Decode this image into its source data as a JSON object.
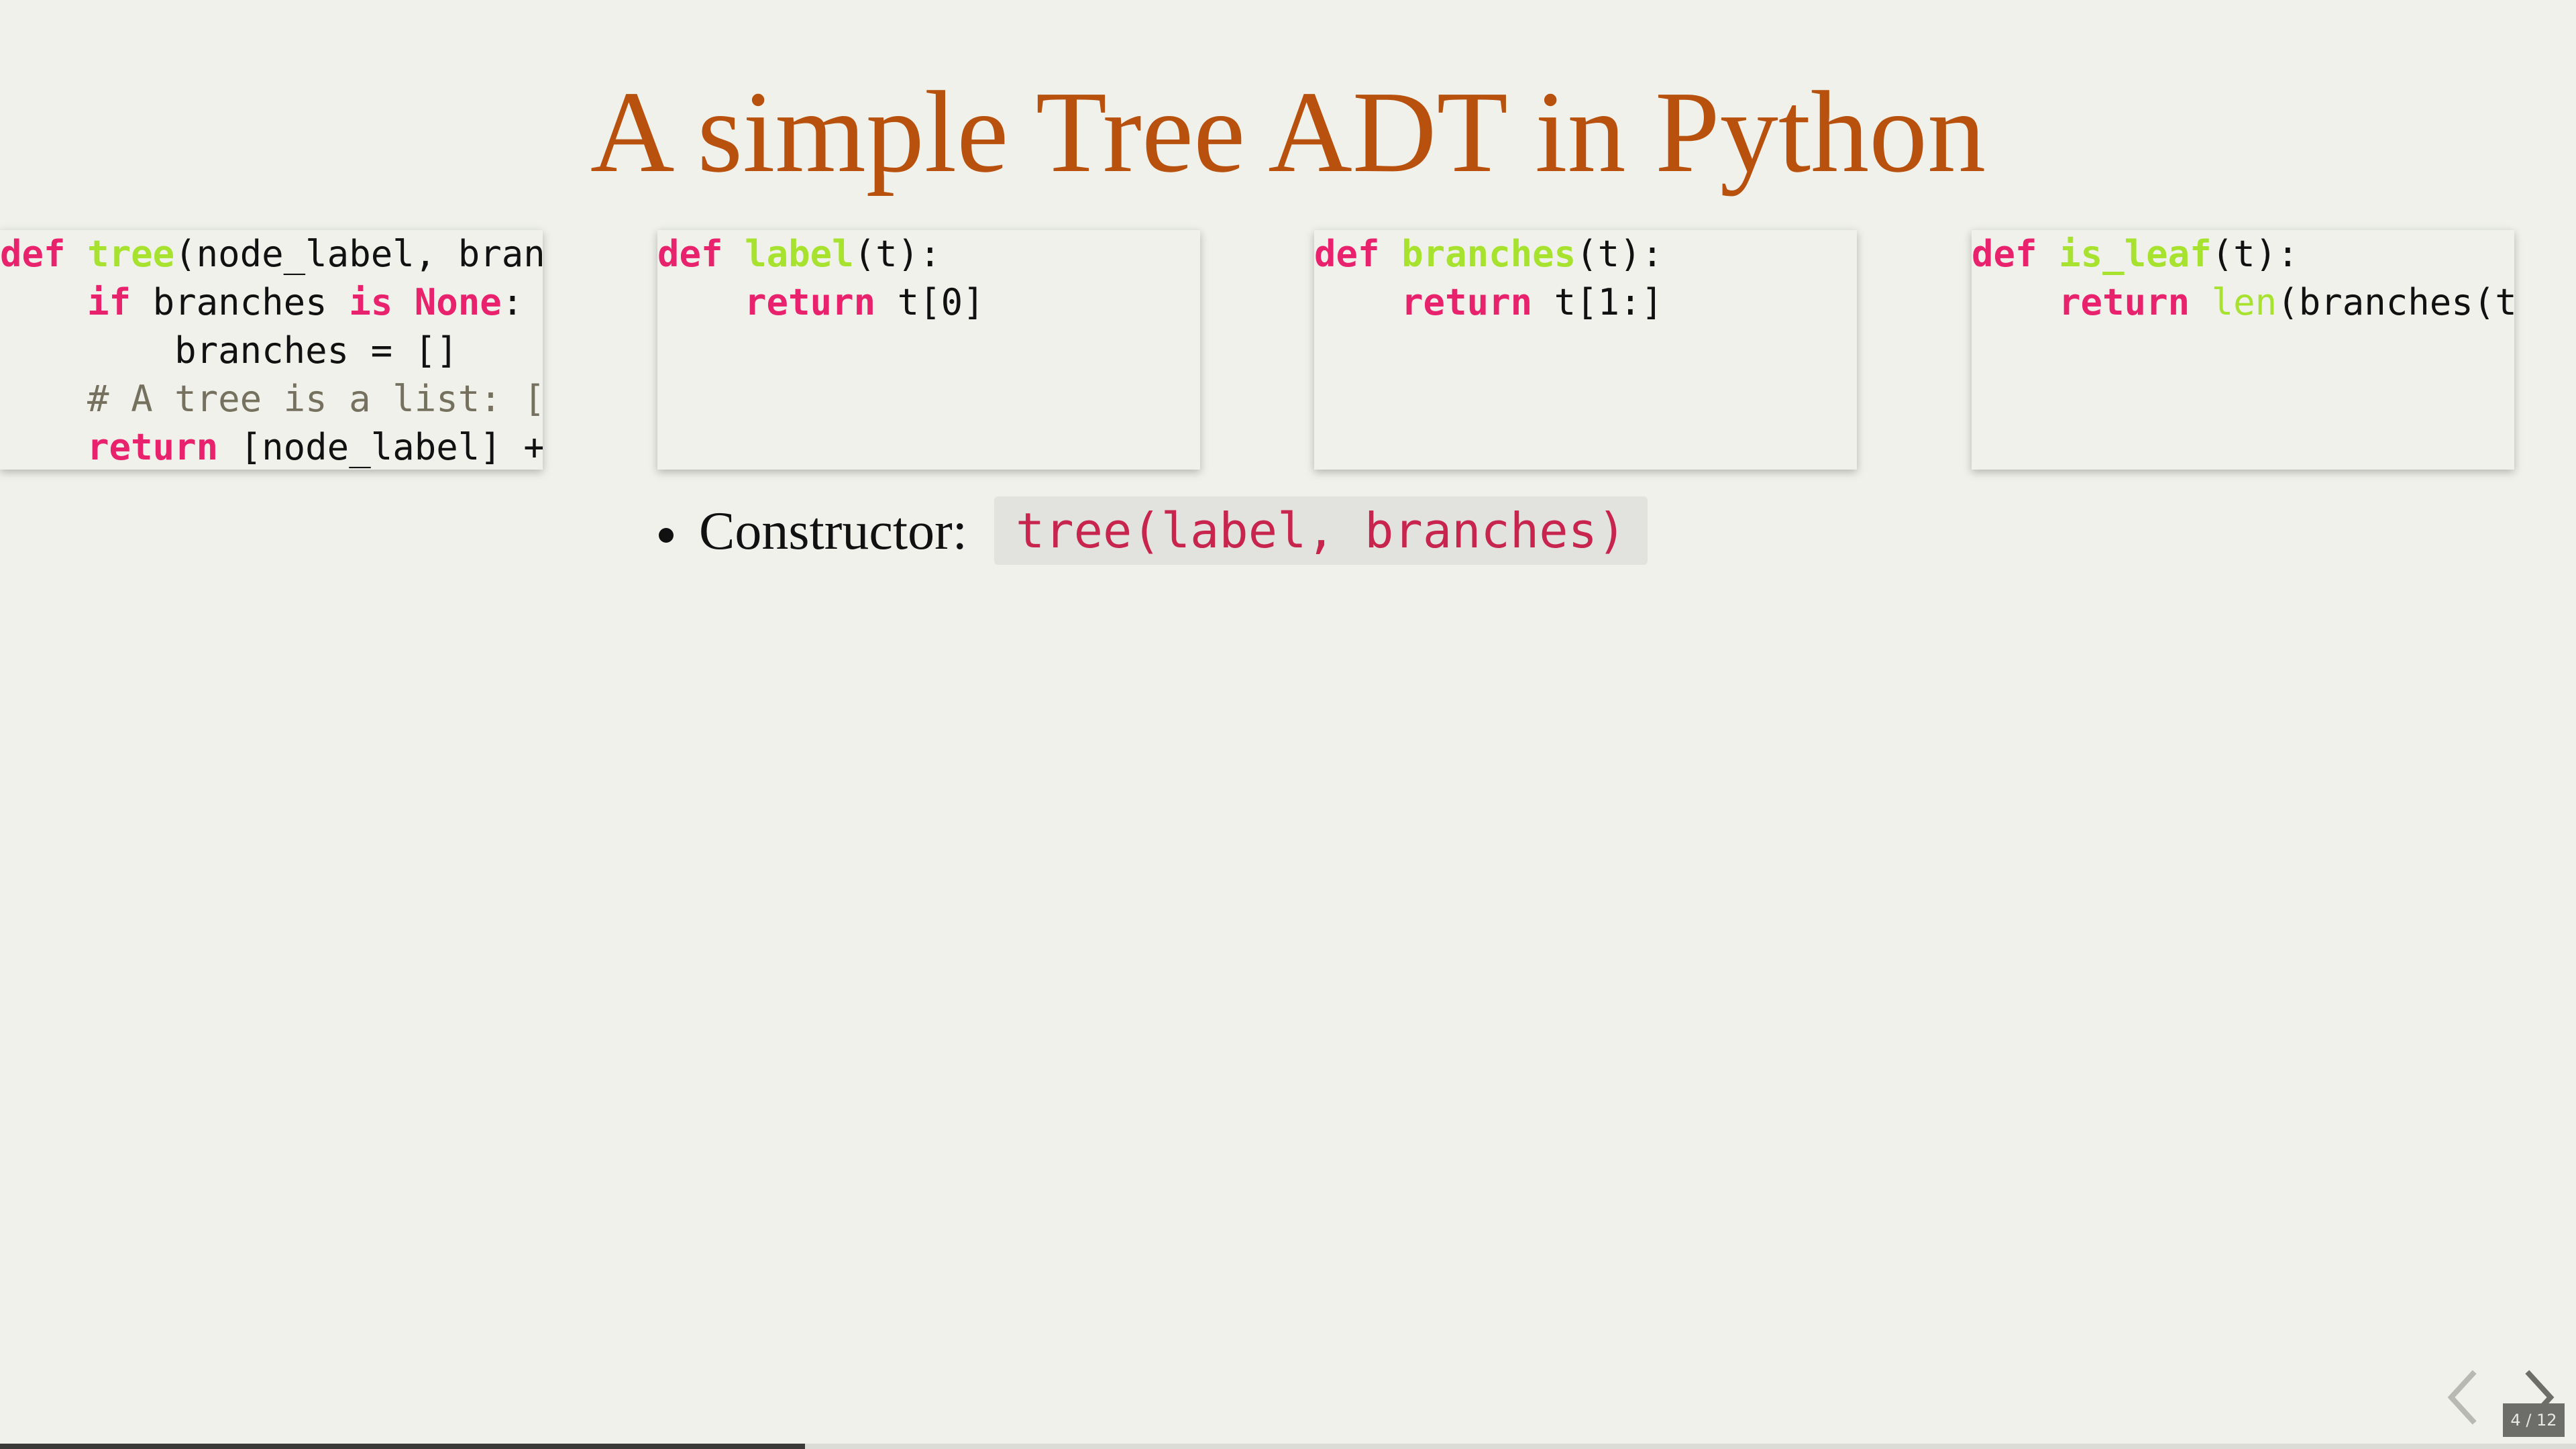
{
  "slide": {
    "title": "A simple Tree ADT in Python"
  },
  "code_boxes": [
    {
      "lines": [
        [
          {
            "t": "def",
            "c": "kw"
          },
          {
            "t": " "
          },
          {
            "t": "tree",
            "c": "fn"
          },
          {
            "t": "(node_label, bran"
          }
        ],
        [
          {
            "t": "    "
          },
          {
            "t": "if",
            "c": "kw"
          },
          {
            "t": " branches "
          },
          {
            "t": "is",
            "c": "kw"
          },
          {
            "t": " "
          },
          {
            "t": "None",
            "c": "kw"
          },
          {
            "t": ":"
          }
        ],
        [
          {
            "t": "        branches = []"
          }
        ],
        [
          {
            "t": "    "
          },
          {
            "t": "# A tree is a list: [",
            "c": "cm"
          }
        ],
        [
          {
            "t": "    "
          },
          {
            "t": "return",
            "c": "kw"
          },
          {
            "t": " [node_label] +"
          }
        ]
      ]
    },
    {
      "lines": [
        [
          {
            "t": "def",
            "c": "kw"
          },
          {
            "t": " "
          },
          {
            "t": "label",
            "c": "fn"
          },
          {
            "t": "(t):"
          }
        ],
        [
          {
            "t": "    "
          },
          {
            "t": "return",
            "c": "kw"
          },
          {
            "t": " t[0]"
          }
        ]
      ]
    },
    {
      "lines": [
        [
          {
            "t": "def",
            "c": "kw"
          },
          {
            "t": " "
          },
          {
            "t": "branches",
            "c": "fn"
          },
          {
            "t": "(t):"
          }
        ],
        [
          {
            "t": "    "
          },
          {
            "t": "return",
            "c": "kw"
          },
          {
            "t": " t[1:]"
          }
        ]
      ]
    },
    {
      "lines": [
        [
          {
            "t": "def",
            "c": "kw"
          },
          {
            "t": " "
          },
          {
            "t": "is_leaf",
            "c": "fn"
          },
          {
            "t": "(t):"
          }
        ],
        [
          {
            "t": "    "
          },
          {
            "t": "return",
            "c": "kw"
          },
          {
            "t": " "
          },
          {
            "t": "len",
            "c": "bi"
          },
          {
            "t": "(branches(t"
          }
        ]
      ]
    }
  ],
  "bullets": [
    {
      "label": "Constructor:",
      "code": "tree(label, branches)"
    }
  ],
  "nav": {
    "counter": "4 / 12",
    "progress": 0.3125,
    "prev_icon": "chevron-left-icon",
    "next_icon": "chevron-right-icon"
  },
  "colors": {
    "background": "#f0f1eb",
    "title": "#b8510d",
    "keyword": "#e8226c",
    "function": "#a6e22e",
    "comment": "#75715e",
    "inline_code": "#c7254e"
  }
}
